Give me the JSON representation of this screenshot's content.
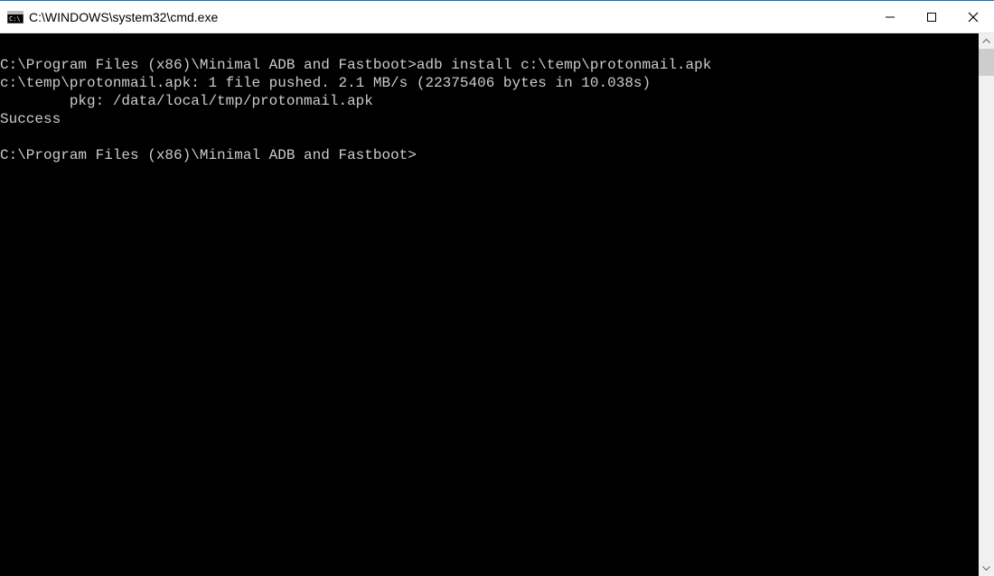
{
  "window": {
    "title": "C:\\WINDOWS\\system32\\cmd.exe"
  },
  "console": {
    "line1_prompt": "C:\\Program Files (x86)\\Minimal ADB and Fastboot>",
    "line1_cmd": "adb install c:\\temp\\protonmail.apk",
    "line2": "c:\\temp\\protonmail.apk: 1 file pushed. 2.1 MB/s (22375406 bytes in 10.038s)",
    "line3": "        pkg: /data/local/tmp/protonmail.apk",
    "line4": "Success",
    "line5_prompt": "C:\\Program Files (x86)\\Minimal ADB and Fastboot>"
  }
}
